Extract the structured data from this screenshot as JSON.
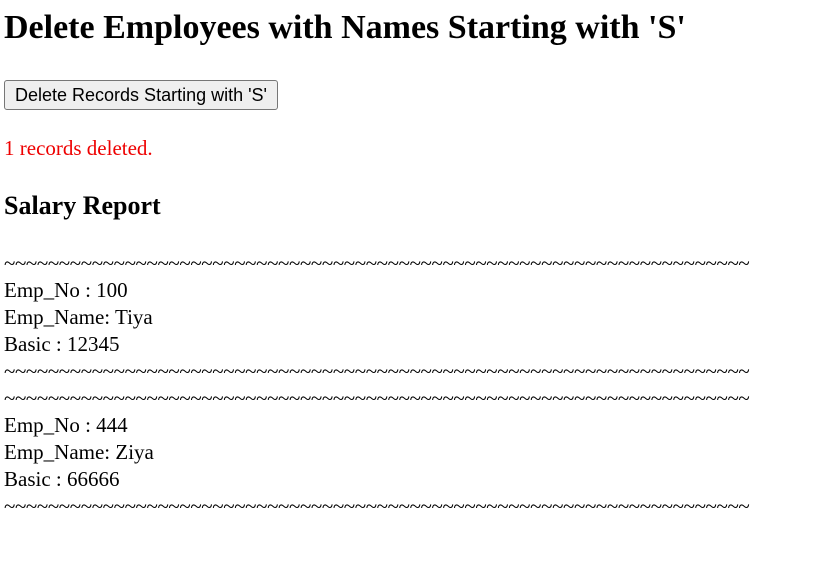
{
  "page": {
    "title": "Delete Employees with Names Starting with 'S'",
    "delete_button_label": "Delete Records Starting with 'S'",
    "status_message": "1 records deleted.",
    "status_color": "#ee0000",
    "section_title": "Salary Report"
  },
  "report": {
    "separator": "~~~~~~~~~~~~~~~~~~~~~~~~~~~~~~~~~~~~~~~~~~~~~~~~~~~~~~~~~~~~~~~~~~~~",
    "records": [
      {
        "emp_no": "Emp_No : 100",
        "emp_name": "Emp_Name: Tiya",
        "basic": "Basic : 12345"
      },
      {
        "emp_no": "Emp_No : 444",
        "emp_name": "Emp_Name: Ziya",
        "basic": "Basic : 66666"
      }
    ]
  }
}
